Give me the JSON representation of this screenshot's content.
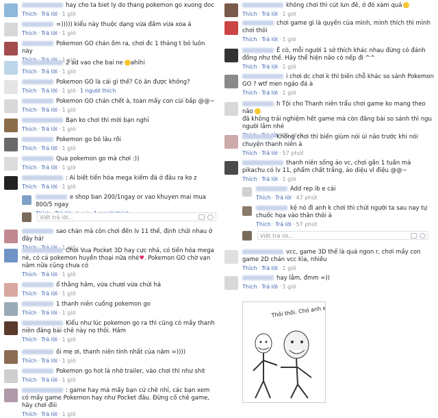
{
  "meta_like": "Thích",
  "meta_reply": "Trả lời",
  "meta_sep": "·",
  "left": [
    {
      "t": "hay cho ta biet ly do thang pokemon go xuong doc",
      "time": "1 giờ"
    },
    {
      "t": "=))))) kiểu này thuộc dạng vừa đấm vừa xoa á",
      "time": "1 giờ"
    },
    {
      "t": "Pokemon GO chán ồm ra, chơi đc 1 tháng t bỏ luôn này",
      "time": "1 giờ"
    },
    {
      "t": "2 ad vao che bai ne",
      "suffix": "ahihi",
      "time": "1 giờ"
    },
    {
      "t": "Pokemon GO là cái gì thế? Có ăn được không?",
      "time": "1 giờ",
      "extra": "1 người thích"
    },
    {
      "t": "Pokemon GO chán chết à, toàn mấy con cùi bắp @@~",
      "time": "1 giờ"
    },
    {
      "t": "Bạn ko chơi thì mời bạn nghỉ",
      "time": "1 giờ"
    },
    {
      "t": "Pokemon go bỏ lâu rồi",
      "time": "1 giờ"
    },
    {
      "t": "Qua pokemon go mà chơi :))",
      "time": "1 giờ"
    },
    {
      "t": ": Ai biết tiến hóa mega kiếm đá ở đâu ra ko z",
      "time": "1 giờ"
    },
    {
      "t": "e shop ban 200/1ngay or vao khuyen mai mua 800/5 ngay",
      "time": "1 giờ",
      "extra": "1 người thích",
      "nested": true
    },
    {
      "t": "sao chán mà còn chơi đến lv 11 thế, định chửi nhau ở đây hả!",
      "time": "1 giờ"
    },
    {
      "t": "Chơi Vua Pocket 3D hay cực nhá, có tiến hóa mega nè, có cả pokemon huyền thoại nữa nhé",
      "suffix": ". Pokemon GO chờ vạn năm nữa cũng chưa có",
      "time": "1 giờ"
    },
    {
      "t": "ổ thằng hâm, vừa chươi vừa chửi hả",
      "time": "1 giờ"
    },
    {
      "t": "1 thanh niên cuồng pokemon go",
      "time": "1 giờ"
    },
    {
      "t": "Kiểu như lúc pokemon go ra thì cũng có mấy thanh niên đăng bài chê này nọ thôi. Hâm",
      "time": "1 giờ"
    },
    {
      "t": "ồi mẹ ơi, thanh niên tỉnh nhất của năm =))))",
      "time": "1 giờ"
    },
    {
      "t": "Pokemon go hot là nhờ trailer, vào chơi thì như shit",
      "time": "1 giờ"
    },
    {
      "t": ": game hay mà mấy bạn cứ chê nhỉ, các bạn xem có mấy game Pokemon hay như Pocket đâu. Đừng cố chê game, hãy chơi điii",
      "time": "1 giờ"
    }
  ],
  "left_input_placeholder": "Viết trả lời...",
  "right": [
    {
      "t": "không chơi thì cút lun đê, ở đó xàm quá",
      "time": "1 giờ"
    },
    {
      "t": "chơi game gì là quyền của mình, mình thích thì mình chơi thôi",
      "time": "1 giờ"
    },
    {
      "t": "Ê cò, mỗi người 1 sở thích khác nhau đừng có đánh đồng như thế. Hãy thể hiện não có nếp đi ^^",
      "time": "1 giờ"
    },
    {
      "t": "i chơi dc chơi k thì biến chỗ khác so sánh Pokemon GO ? wtf men ngáo đá à",
      "time": "1 giờ"
    },
    {
      "t": "h Tội cho Thanh niên trẩu chơi game ko mang theo não",
      "suffix2": "đã không trải nghiệm hết game mà còn đăng bài so sánh thì ngu người lắm nhé",
      "time": "55 phút"
    },
    {
      "t": "Không chơi thì biến giùm nói ùi não trước khi nói chuyện thanh niên à",
      "time": "57 phút"
    },
    {
      "t": "thanh niên sống ảo vc, chơi gần 1 tuần mà pikachu có lv 11, phẩm chất trắng, ảo diệu vl điệu @@~",
      "time": "1 giờ"
    },
    {
      "t": "Add rep ib e cái",
      "time": "47 phút",
      "nested": true
    },
    {
      "t": "kệ nó đi anh k chơi thì chửi người ta sau nay tự chuốc họa vào thân thôi à",
      "time": "57 phút",
      "nested": true
    },
    {
      "t": "vcc, game 3D thế là quá ngon r, chơi mấy con game 2D chán vcc kìa, nhiều",
      "time": "1 giờ"
    },
    {
      "t": "hay lắm, đmm =))",
      "time": "1 giờ"
    }
  ],
  "right_input_placeholder": "Viết trả lời...",
  "meme_text": "Thôi thôi. Chó anh em cả mà!"
}
